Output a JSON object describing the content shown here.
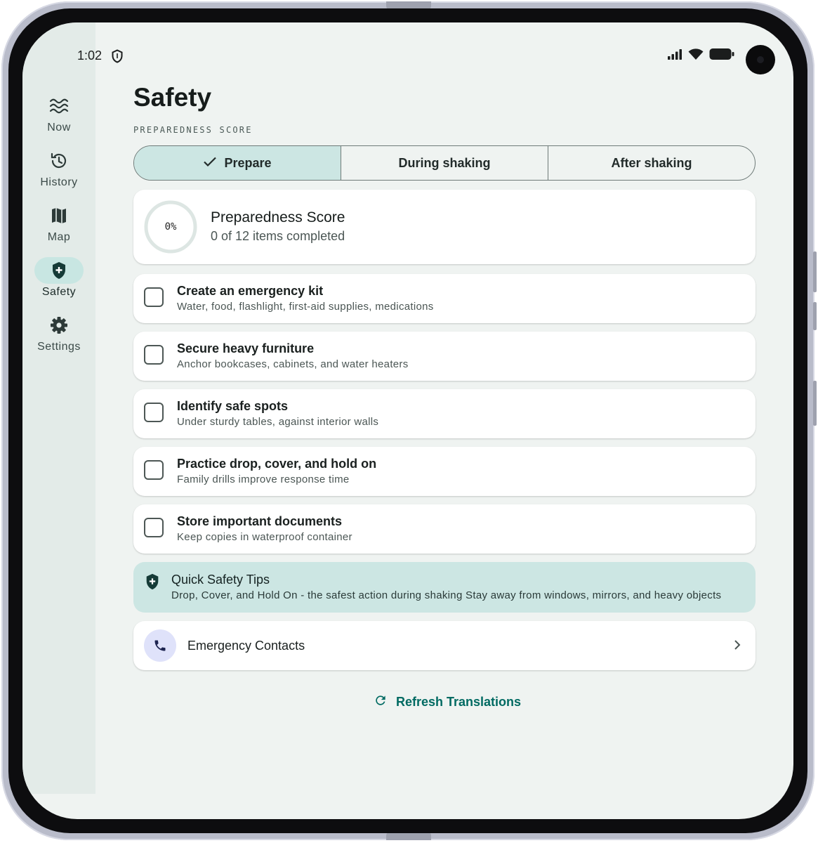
{
  "status_bar": {
    "time": "1:02"
  },
  "nav": {
    "items": [
      {
        "label": "Now",
        "icon": "waves-icon",
        "active": false
      },
      {
        "label": "History",
        "icon": "history-icon",
        "active": false
      },
      {
        "label": "Map",
        "icon": "map-icon",
        "active": false
      },
      {
        "label": "Safety",
        "icon": "shield-plus-icon",
        "active": true
      },
      {
        "label": "Settings",
        "icon": "gear-icon",
        "active": false
      }
    ]
  },
  "page": {
    "title": "Safety",
    "subtitle": "PREPAREDNESS SCORE"
  },
  "tabs": [
    {
      "label": "Prepare",
      "selected": true
    },
    {
      "label": "During shaking",
      "selected": false
    },
    {
      "label": "After shaking",
      "selected": false
    }
  ],
  "score": {
    "percent_text": "0%",
    "progress_fraction": 0,
    "title": "Preparedness Score",
    "subtitle": "0 of 12 items completed"
  },
  "checklist": [
    {
      "title": "Create an emergency kit",
      "subtitle": "Water, food, flashlight, first-aid supplies, medications",
      "checked": false
    },
    {
      "title": "Secure heavy furniture",
      "subtitle": "Anchor bookcases, cabinets, and water heaters",
      "checked": false
    },
    {
      "title": "Identify safe spots",
      "subtitle": "Under sturdy tables, against interior walls",
      "checked": false
    },
    {
      "title": "Practice drop, cover, and hold on",
      "subtitle": "Family drills improve response time",
      "checked": false
    },
    {
      "title": "Store important documents",
      "subtitle": "Keep copies in waterproof container",
      "checked": false
    }
  ],
  "tips": {
    "title": "Quick Safety Tips",
    "body": "Drop, Cover, and Hold On - the safest action during shaking Stay away from windows, mirrors, and heavy objects"
  },
  "contacts": {
    "label": "Emergency Contacts"
  },
  "refresh": {
    "label": "Refresh Translations"
  },
  "colors": {
    "accent": "#006a62",
    "selected_tab": "#cce6e3",
    "screen_bg": "#eff3f1",
    "rail_bg": "#e3ebe8"
  }
}
